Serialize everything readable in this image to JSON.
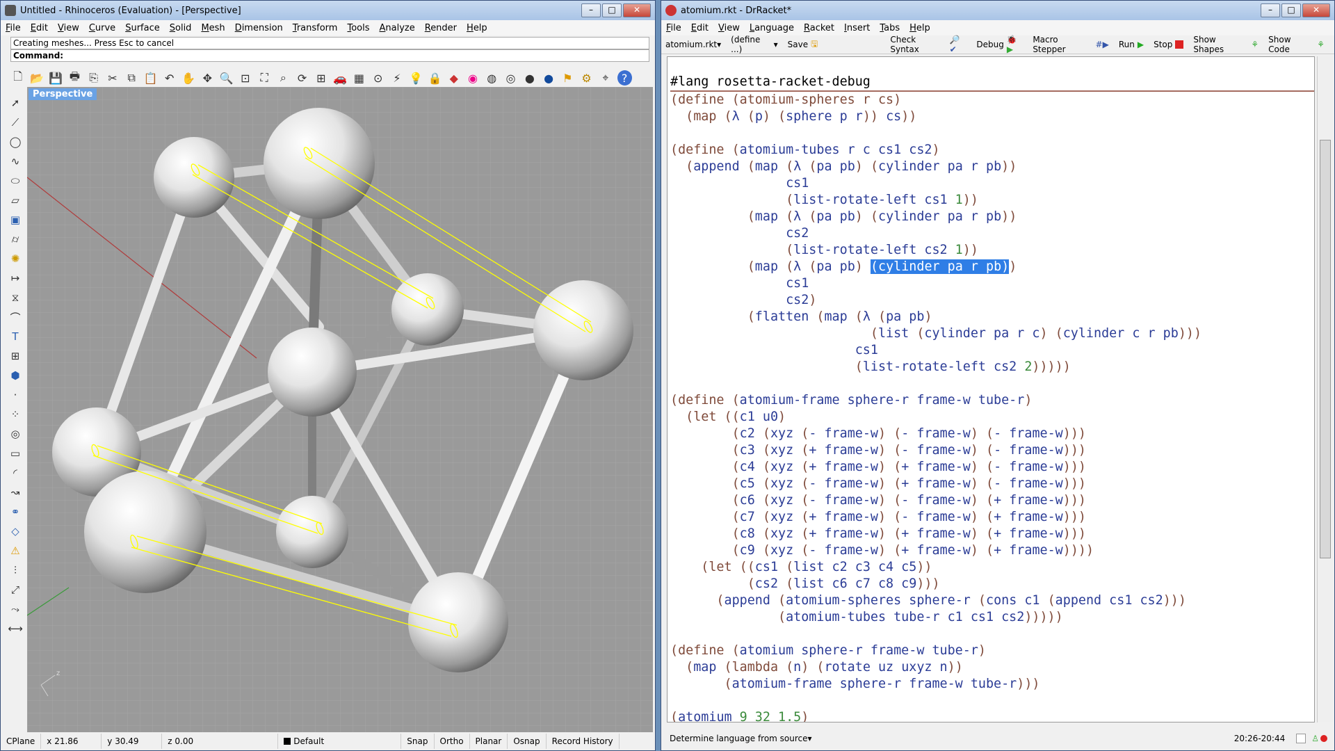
{
  "rhino": {
    "title": "Untitled - Rhinoceros (Evaluation) - [Perspective]",
    "menu": [
      "File",
      "Edit",
      "View",
      "Curve",
      "Surface",
      "Solid",
      "Mesh",
      "Dimension",
      "Transform",
      "Tools",
      "Analyze",
      "Render",
      "Help"
    ],
    "status_message": "Creating meshes... Press Esc to cancel",
    "command_label": "Command:",
    "viewport_label": "Perspective",
    "statusbar": {
      "cplane": "CPlane",
      "x": "x 21.86",
      "y": "y 30.49",
      "z": "z 0.00",
      "layer": "Default",
      "snap": "Snap",
      "ortho": "Ortho",
      "planar": "Planar",
      "osnap": "Osnap",
      "history": "Record History"
    }
  },
  "drracket": {
    "title": "atomium.rkt - DrRacket*",
    "menu": [
      "File",
      "Edit",
      "View",
      "Language",
      "Racket",
      "Insert",
      "Tabs",
      "Help"
    ],
    "toolbar": {
      "file": "atomium.rkt",
      "define": "(define ...)",
      "save": "Save",
      "check_syntax": "Check Syntax",
      "debug": "Debug",
      "macro_stepper": "Macro Stepper",
      "run": "Run",
      "stop": "Stop",
      "show_shapes": "Show Shapes",
      "show_code": "Show Code"
    },
    "lang_line": "#lang rosetta-racket-debug",
    "language_selector": "Determine language from source",
    "time": "20:26-20:44"
  }
}
